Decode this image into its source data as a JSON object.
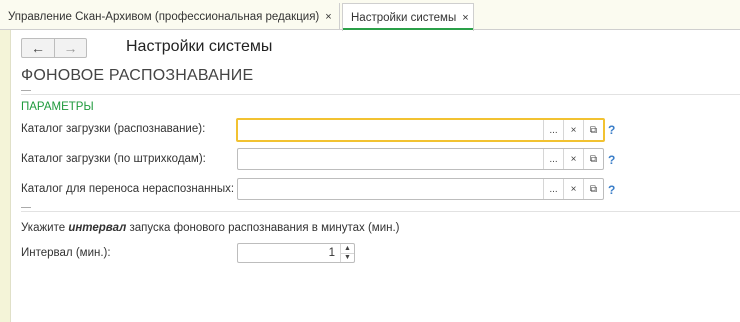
{
  "tabs": [
    {
      "label": "Управление Скан-Архивом (профессиональная редакция)",
      "close": "×"
    },
    {
      "label": "Настройки системы",
      "close": "×"
    }
  ],
  "nav": {
    "back": "←",
    "forward": "→"
  },
  "form": {
    "title": "Настройки системы",
    "section_title": "ФОНОВОЕ РАСПОЗНАВАНИЕ",
    "group_title": "ПАРАМЕТРЫ",
    "fields": [
      {
        "label": "Каталог загрузки (распознавание):",
        "value": "",
        "select": "...",
        "clear": "×",
        "open": "⧉",
        "help": "?"
      },
      {
        "label": "Каталог загрузки (по штрихкодам):",
        "value": "",
        "select": "...",
        "clear": "×",
        "open": "⧉",
        "help": "?"
      },
      {
        "label": "Каталог для переноса нераспознанных:",
        "value": "",
        "select": "...",
        "clear": "×",
        "open": "⧉",
        "help": "?"
      }
    ],
    "hint": {
      "before": "Укажите ",
      "emphasis": "интервал",
      "after": " запуска фонового распознавания в минутах (мин.)"
    },
    "interval": {
      "label": "Интервал (мин.):",
      "value": "1",
      "up": "▲",
      "down": "▼"
    }
  }
}
